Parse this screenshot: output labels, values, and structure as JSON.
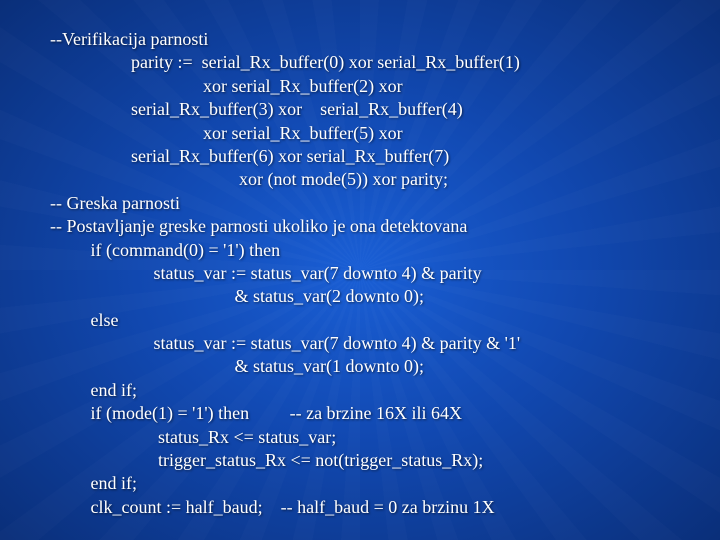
{
  "code": {
    "l01": "--Verifikacija parnosti",
    "l02": "                  parity :=  serial_Rx_buffer(0) xor serial_Rx_buffer(1)",
    "l03": "                                  xor serial_Rx_buffer(2) xor",
    "l04": "                  serial_Rx_buffer(3) xor    serial_Rx_buffer(4)",
    "l05": "                                  xor serial_Rx_buffer(5) xor",
    "l06": "                  serial_Rx_buffer(6) xor serial_Rx_buffer(7)",
    "l07": "                                          xor (not mode(5)) xor parity;",
    "l08": "-- Greska parnosti",
    "l09": "-- Postavljanje greske parnosti ukoliko je ona detektovana",
    "l10": "         if (command(0) = '1') then",
    "l11": "                       status_var := status_var(7 downto 4) & parity",
    "l12": "                                         & status_var(2 downto 0);",
    "l13": "         else",
    "l14": "                       status_var := status_var(7 downto 4) & parity & '1'",
    "l15": "                                         & status_var(1 downto 0);",
    "l16": "         end if;",
    "l17": "         if (mode(1) = '1') then         -- za brzine 16X ili 64X",
    "l18": "                        status_Rx <= status_var;",
    "l19": "                        trigger_status_Rx <= not(trigger_status_Rx);",
    "l20": "         end if;",
    "l21": "         clk_count := half_baud;    -- half_baud = 0 za brzinu 1X"
  }
}
